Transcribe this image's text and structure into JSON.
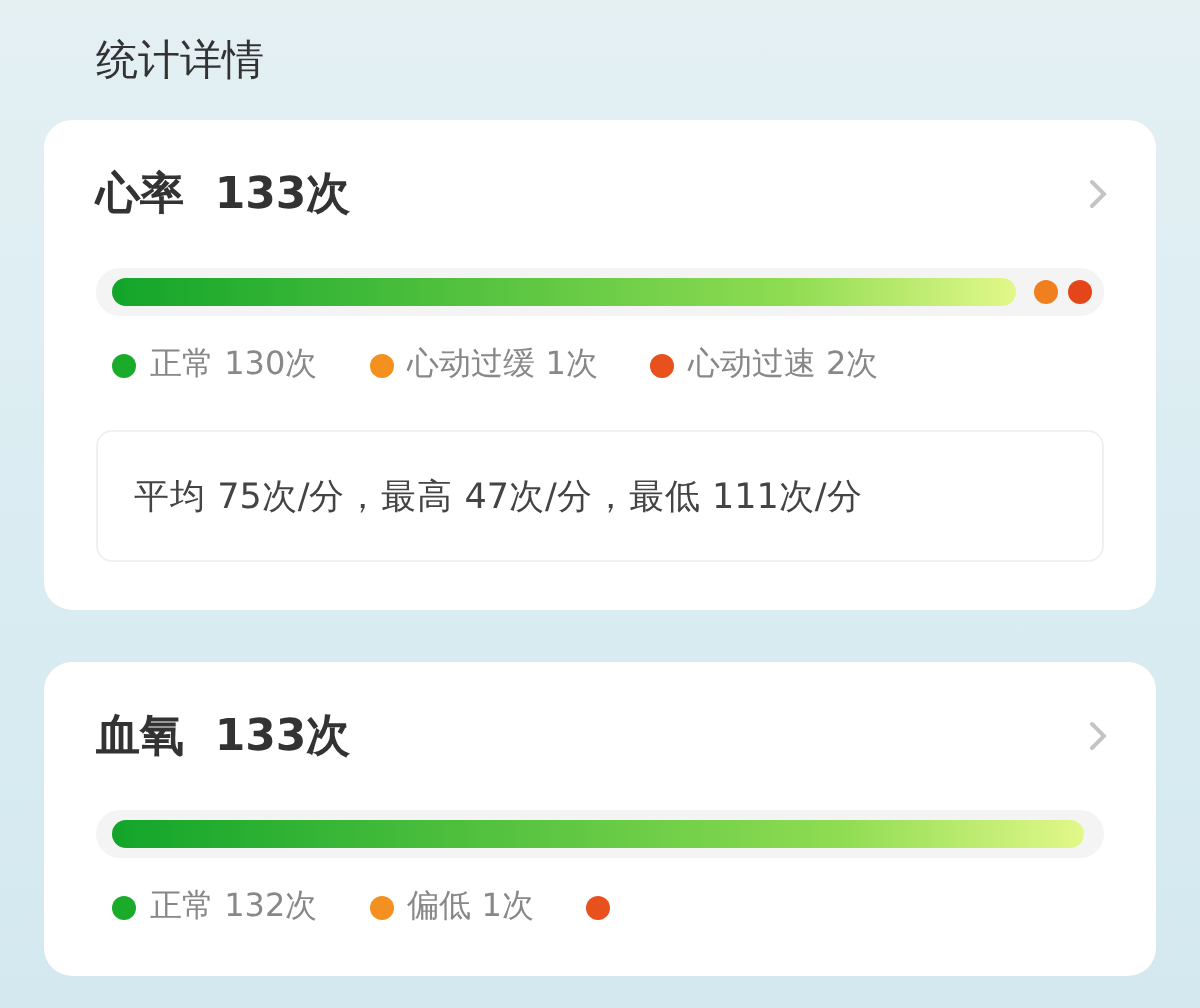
{
  "section_title": "统计详情",
  "cards": [
    {
      "name": "心率",
      "count": "133次",
      "markers": [
        {
          "color": "#f0801e"
        },
        {
          "color": "#e4461a"
        }
      ],
      "legend": [
        {
          "color": "#1aab2b",
          "label": "正常 130次"
        },
        {
          "color": "#f3901f",
          "label": "心动过缓 1次"
        },
        {
          "color": "#e8501e",
          "label": "心动过速 2次"
        }
      ],
      "summary": "平均 75次/分，最高 47次/分，最低 111次/分"
    },
    {
      "name": "血氧",
      "count": "133次",
      "legend": [
        {
          "color": "#1aab2b",
          "label": "正常 132次"
        },
        {
          "color": "#f3901f",
          "label": "偏低 1次"
        },
        {
          "color": "#e8501e"
        }
      ]
    }
  ]
}
